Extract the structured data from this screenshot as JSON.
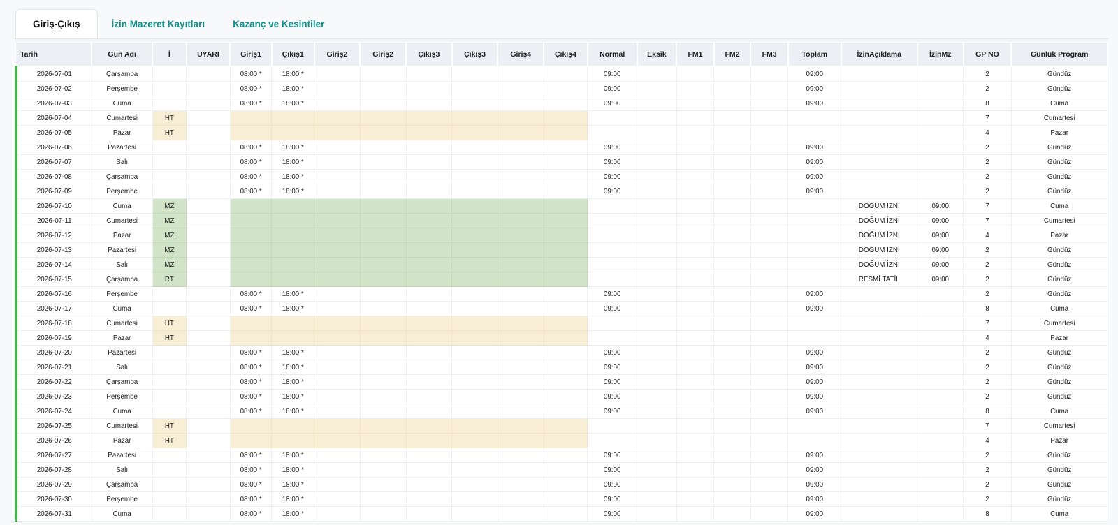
{
  "tabs": [
    "Giriş-Çıkış",
    "İzin Mazeret Kayıtları",
    "Kazanç ve Kesintiler"
  ],
  "columns": [
    "Tarih",
    "Gün Adı",
    "İ",
    "UYARI",
    "Giriş1",
    "Çıkış1",
    "Giriş2",
    "Giriş2",
    "Çıkış3",
    "Çıkış3",
    "Giriş4",
    "Çıkış4",
    "Normal",
    "Eksik",
    "FM1",
    "FM2",
    "FM3",
    "Toplam",
    "İzinAçıklama",
    "İzinMz",
    "GP NO",
    "Günlük Program"
  ],
  "rows": [
    {
      "date": "2026-07-01",
      "day": "Çarşamba",
      "i": "",
      "in1": "08:00 *",
      "out1": "18:00 *",
      "normal": "09:00",
      "total": "09:00",
      "desc": "",
      "izinmz": "",
      "gp": "2",
      "program": "Gündüz"
    },
    {
      "date": "2026-07-02",
      "day": "Perşembe",
      "i": "",
      "in1": "08:00 *",
      "out1": "18:00 *",
      "normal": "09:00",
      "total": "09:00",
      "desc": "",
      "izinmz": "",
      "gp": "2",
      "program": "Gündüz"
    },
    {
      "date": "2026-07-03",
      "day": "Cuma",
      "i": "",
      "in1": "08:00 *",
      "out1": "18:00 *",
      "normal": "09:00",
      "total": "09:00",
      "desc": "",
      "izinmz": "",
      "gp": "8",
      "program": "Cuma"
    },
    {
      "date": "2026-07-04",
      "day": "Cumartesi",
      "i": "HT",
      "in1": "",
      "out1": "",
      "normal": "",
      "total": "",
      "desc": "",
      "izinmz": "",
      "gp": "7",
      "program": "Cumartesi"
    },
    {
      "date": "2026-07-05",
      "day": "Pazar",
      "i": "HT",
      "in1": "",
      "out1": "",
      "normal": "",
      "total": "",
      "desc": "",
      "izinmz": "",
      "gp": "4",
      "program": "Pazar"
    },
    {
      "date": "2026-07-06",
      "day": "Pazartesi",
      "i": "",
      "in1": "08:00 *",
      "out1": "18:00 *",
      "normal": "09:00",
      "total": "09:00",
      "desc": "",
      "izinmz": "",
      "gp": "2",
      "program": "Gündüz"
    },
    {
      "date": "2026-07-07",
      "day": "Salı",
      "i": "",
      "in1": "08:00 *",
      "out1": "18:00 *",
      "normal": "09:00",
      "total": "09:00",
      "desc": "",
      "izinmz": "",
      "gp": "2",
      "program": "Gündüz"
    },
    {
      "date": "2026-07-08",
      "day": "Çarşamba",
      "i": "",
      "in1": "08:00 *",
      "out1": "18:00 *",
      "normal": "09:00",
      "total": "09:00",
      "desc": "",
      "izinmz": "",
      "gp": "2",
      "program": "Gündüz"
    },
    {
      "date": "2026-07-09",
      "day": "Perşembe",
      "i": "",
      "in1": "08:00 *",
      "out1": "18:00 *",
      "normal": "09:00",
      "total": "09:00",
      "desc": "",
      "izinmz": "",
      "gp": "2",
      "program": "Gündüz"
    },
    {
      "date": "2026-07-10",
      "day": "Cuma",
      "i": "MZ",
      "in1": "",
      "out1": "",
      "normal": "",
      "total": "",
      "desc": "DOĞUM İZNİ",
      "izinmz": "09:00",
      "gp": "7",
      "program": "Cuma"
    },
    {
      "date": "2026-07-11",
      "day": "Cumartesi",
      "i": "MZ",
      "in1": "",
      "out1": "",
      "normal": "",
      "total": "",
      "desc": "DOĞUM İZNİ",
      "izinmz": "09:00",
      "gp": "7",
      "program": "Cumartesi"
    },
    {
      "date": "2026-07-12",
      "day": "Pazar",
      "i": "MZ",
      "in1": "",
      "out1": "",
      "normal": "",
      "total": "",
      "desc": "DOĞUM İZNİ",
      "izinmz": "09:00",
      "gp": "4",
      "program": "Pazar"
    },
    {
      "date": "2026-07-13",
      "day": "Pazartesi",
      "i": "MZ",
      "in1": "",
      "out1": "",
      "normal": "",
      "total": "",
      "desc": "DOĞUM İZNİ",
      "izinmz": "09:00",
      "gp": "2",
      "program": "Gündüz"
    },
    {
      "date": "2026-07-14",
      "day": "Salı",
      "i": "MZ",
      "in1": "",
      "out1": "",
      "normal": "",
      "total": "",
      "desc": "DOĞUM İZNİ",
      "izinmz": "09:00",
      "gp": "2",
      "program": "Gündüz"
    },
    {
      "date": "2026-07-15",
      "day": "Çarşamba",
      "i": "RT",
      "in1": "",
      "out1": "",
      "normal": "",
      "total": "",
      "desc": "RESMİ TATİL",
      "izinmz": "09:00",
      "gp": "2",
      "program": "Gündüz"
    },
    {
      "date": "2026-07-16",
      "day": "Perşembe",
      "i": "",
      "in1": "08:00 *",
      "out1": "18:00 *",
      "normal": "09:00",
      "total": "09:00",
      "desc": "",
      "izinmz": "",
      "gp": "2",
      "program": "Gündüz"
    },
    {
      "date": "2026-07-17",
      "day": "Cuma",
      "i": "",
      "in1": "08:00 *",
      "out1": "18:00 *",
      "normal": "09:00",
      "total": "09:00",
      "desc": "",
      "izinmz": "",
      "gp": "8",
      "program": "Cuma"
    },
    {
      "date": "2026-07-18",
      "day": "Cumartesi",
      "i": "HT",
      "in1": "",
      "out1": "",
      "normal": "",
      "total": "",
      "desc": "",
      "izinmz": "",
      "gp": "7",
      "program": "Cumartesi"
    },
    {
      "date": "2026-07-19",
      "day": "Pazar",
      "i": "HT",
      "in1": "",
      "out1": "",
      "normal": "",
      "total": "",
      "desc": "",
      "izinmz": "",
      "gp": "4",
      "program": "Pazar"
    },
    {
      "date": "2026-07-20",
      "day": "Pazartesi",
      "i": "",
      "in1": "08:00 *",
      "out1": "18:00 *",
      "normal": "09:00",
      "total": "09:00",
      "desc": "",
      "izinmz": "",
      "gp": "2",
      "program": "Gündüz"
    },
    {
      "date": "2026-07-21",
      "day": "Salı",
      "i": "",
      "in1": "08:00 *",
      "out1": "18:00 *",
      "normal": "09:00",
      "total": "09:00",
      "desc": "",
      "izinmz": "",
      "gp": "2",
      "program": "Gündüz"
    },
    {
      "date": "2026-07-22",
      "day": "Çarşamba",
      "i": "",
      "in1": "08:00 *",
      "out1": "18:00 *",
      "normal": "09:00",
      "total": "09:00",
      "desc": "",
      "izinmz": "",
      "gp": "2",
      "program": "Gündüz"
    },
    {
      "date": "2026-07-23",
      "day": "Perşembe",
      "i": "",
      "in1": "08:00 *",
      "out1": "18:00 *",
      "normal": "09:00",
      "total": "09:00",
      "desc": "",
      "izinmz": "",
      "gp": "2",
      "program": "Gündüz"
    },
    {
      "date": "2026-07-24",
      "day": "Cuma",
      "i": "",
      "in1": "08:00 *",
      "out1": "18:00 *",
      "normal": "09:00",
      "total": "09:00",
      "desc": "",
      "izinmz": "",
      "gp": "8",
      "program": "Cuma"
    },
    {
      "date": "2026-07-25",
      "day": "Cumartesi",
      "i": "HT",
      "in1": "",
      "out1": "",
      "normal": "",
      "total": "",
      "desc": "",
      "izinmz": "",
      "gp": "7",
      "program": "Cumartesi"
    },
    {
      "date": "2026-07-26",
      "day": "Pazar",
      "i": "HT",
      "in1": "",
      "out1": "",
      "normal": "",
      "total": "",
      "desc": "",
      "izinmz": "",
      "gp": "4",
      "program": "Pazar"
    },
    {
      "date": "2026-07-27",
      "day": "Pazartesi",
      "i": "",
      "in1": "08:00 *",
      "out1": "18:00 *",
      "normal": "09:00",
      "total": "09:00",
      "desc": "",
      "izinmz": "",
      "gp": "2",
      "program": "Gündüz"
    },
    {
      "date": "2026-07-28",
      "day": "Salı",
      "i": "",
      "in1": "08:00 *",
      "out1": "18:00 *",
      "normal": "09:00",
      "total": "09:00",
      "desc": "",
      "izinmz": "",
      "gp": "2",
      "program": "Gündüz"
    },
    {
      "date": "2026-07-29",
      "day": "Çarşamba",
      "i": "",
      "in1": "08:00 *",
      "out1": "18:00 *",
      "normal": "09:00",
      "total": "09:00",
      "desc": "",
      "izinmz": "",
      "gp": "2",
      "program": "Gündüz"
    },
    {
      "date": "2026-07-30",
      "day": "Perşembe",
      "i": "",
      "in1": "08:00 *",
      "out1": "18:00 *",
      "normal": "09:00",
      "total": "09:00",
      "desc": "",
      "izinmz": "",
      "gp": "2",
      "program": "Gündüz"
    },
    {
      "date": "2026-07-31",
      "day": "Cuma",
      "i": "",
      "in1": "08:00 *",
      "out1": "18:00 *",
      "normal": "09:00",
      "total": "09:00",
      "desc": "",
      "izinmz": "",
      "gp": "8",
      "program": "Cuma"
    }
  ],
  "colors": {
    "accent": "#138f8a",
    "row_marker": "#4caf50",
    "holiday_fill": "#f8eed6",
    "leave_fill": "#d1e4c7",
    "header_bg": "#eceff4"
  }
}
